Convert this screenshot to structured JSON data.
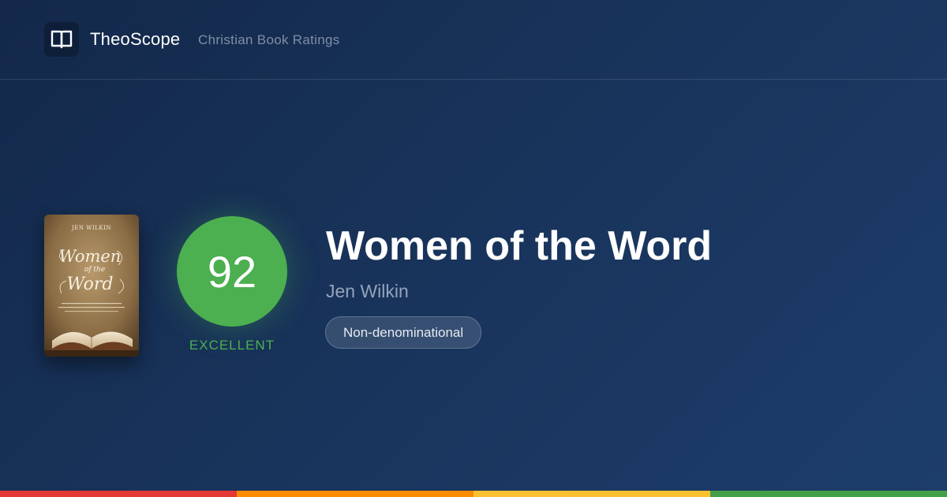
{
  "header": {
    "brand_name": "TheoScope",
    "brand_subtitle": "Christian Book Ratings",
    "logo_icon": "open-book-icon"
  },
  "book": {
    "cover": {
      "author_text": "JEN WILKIN",
      "title_line1": "Women",
      "title_line2": "of the",
      "title_line3": "Word"
    },
    "title": "Women of the Word",
    "author": "Jen Wilkin",
    "tag": "Non-denominational"
  },
  "score": {
    "value": "92",
    "label": "EXCELLENT",
    "color": "#4caf50"
  },
  "rating_scale_colors": [
    "#e53935",
    "#fb8c00",
    "#fbc02d",
    "#43a047"
  ]
}
